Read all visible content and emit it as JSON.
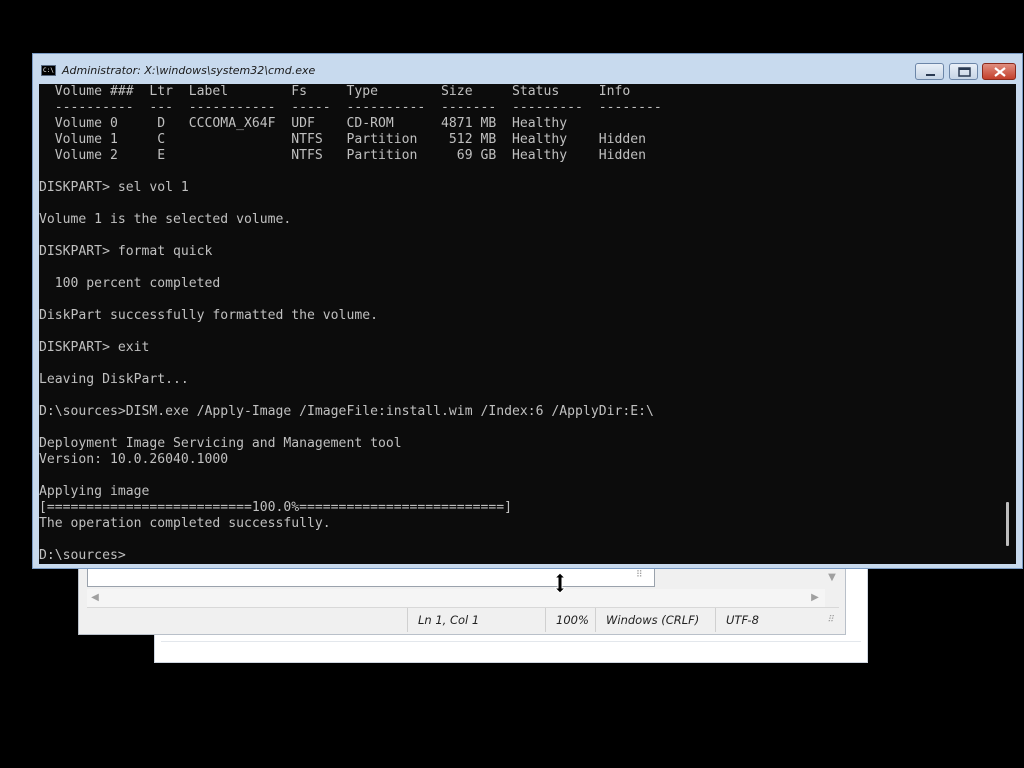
{
  "console_window": {
    "title": "Administrator: X:\\windows\\system32\\cmd.exe",
    "icon": "cmd-icon",
    "buttons": {
      "minimize": "minimize-icon",
      "maximize": "maximize-icon",
      "close": "close-icon"
    },
    "lines": [
      "  Volume ###  Ltr  Label        Fs     Type        Size     Status     Info",
      "  ----------  ---  -----------  -----  ----------  -------  ---------  --------",
      "  Volume 0     D   CCCOMA_X64F  UDF    CD-ROM      4871 MB  Healthy",
      "  Volume 1     C                NTFS   Partition    512 MB  Healthy    Hidden",
      "  Volume 2     E                NTFS   Partition     69 GB  Healthy    Hidden",
      "",
      "DISKPART> sel vol 1",
      "",
      "Volume 1 is the selected volume.",
      "",
      "DISKPART> format quick",
      "",
      "  100 percent completed",
      "",
      "DiskPart successfully formatted the volume.",
      "",
      "DISKPART> exit",
      "",
      "Leaving DiskPart...",
      "",
      "D:\\sources>DISM.exe /Apply-Image /ImageFile:install.wim /Index:6 /ApplyDir:E:\\",
      "",
      "Deployment Image Servicing and Management tool",
      "Version: 10.0.26040.1000",
      "",
      "Applying image",
      "[==========================100.0%==========================]",
      "The operation completed successfully.",
      "",
      "D:\\sources>"
    ]
  },
  "notepad_window": {
    "status": {
      "position": "Ln 1, Col 1",
      "zoom": "100%",
      "line_ending": "Windows (CRLF)",
      "encoding": "UTF-8"
    },
    "scroll_arrows": {
      "left": "◀",
      "right": "▶",
      "down": "▼"
    }
  },
  "colors": {
    "desktop": "#000000",
    "console_bg": "#0c0c0c",
    "console_text": "#c0c0c0",
    "frame": "#c8daee",
    "close_button": "#c4402c"
  }
}
